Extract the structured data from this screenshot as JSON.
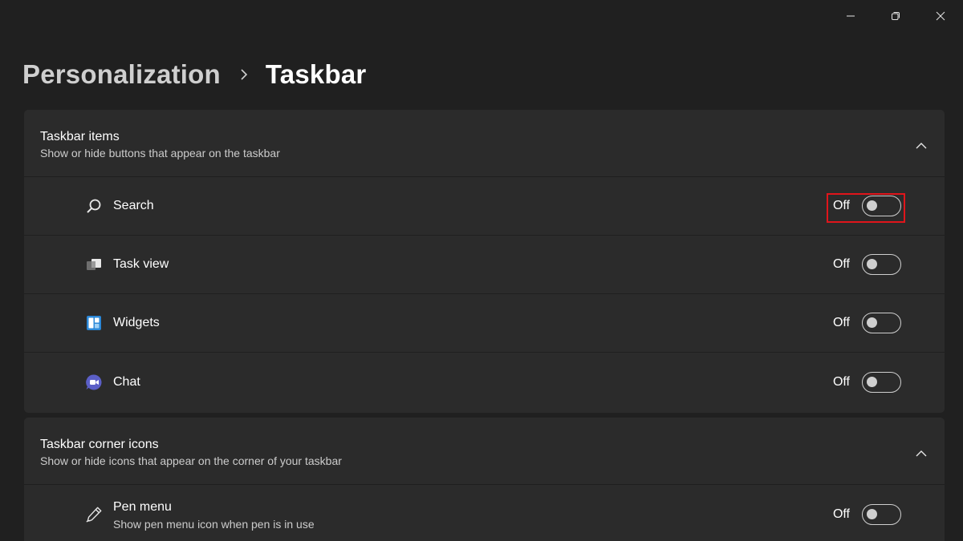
{
  "window": {
    "controls": [
      {
        "name": "minimize-icon"
      },
      {
        "name": "restore-icon"
      },
      {
        "name": "close-icon"
      }
    ]
  },
  "breadcrumb": {
    "parent": "Personalization",
    "separator_icon": "chevron-right-icon",
    "current": "Taskbar"
  },
  "groups": [
    {
      "title": "Taskbar items",
      "description": "Show or hide buttons that appear on the taskbar",
      "expanded": true,
      "items": [
        {
          "label": "Search",
          "icon": "search-icon",
          "state": "Off",
          "on": false,
          "highlighted": true
        },
        {
          "label": "Task view",
          "icon": "task-view-icon",
          "state": "Off",
          "on": false
        },
        {
          "label": "Widgets",
          "icon": "widgets-icon",
          "state": "Off",
          "on": false
        },
        {
          "label": "Chat",
          "icon": "chat-icon",
          "state": "Off",
          "on": false
        }
      ]
    },
    {
      "title": "Taskbar corner icons",
      "description": "Show or hide icons that appear on the corner of your taskbar",
      "expanded": true,
      "items": [
        {
          "label": "Pen menu",
          "description": "Show pen menu icon when pen is in use",
          "icon": "pen-icon",
          "state": "Off",
          "on": false
        }
      ]
    }
  ],
  "colors": {
    "background": "#202020",
    "card": "#2b2b2b",
    "highlight": "#e0151b",
    "chat_accent": "#5b5fc7",
    "widgets_accent": "#2b88d8"
  }
}
